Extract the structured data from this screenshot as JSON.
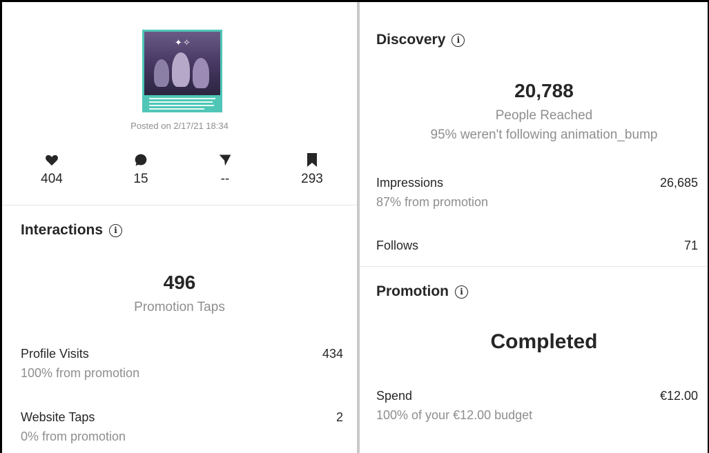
{
  "post": {
    "posted_text": "Posted on 2/17/21 18:34",
    "stats": [
      {
        "icon": "heart-icon",
        "value": "404"
      },
      {
        "icon": "comment-icon",
        "value": "15"
      },
      {
        "icon": "share-icon",
        "value": "--"
      },
      {
        "icon": "bookmark-icon",
        "value": "293"
      }
    ]
  },
  "interactions": {
    "title": "Interactions",
    "total": "496",
    "total_label": "Promotion Taps",
    "rows": [
      {
        "label": "Profile Visits",
        "sub": "100% from promotion",
        "value": "434"
      },
      {
        "label": "Website Taps",
        "sub": "0% from promotion",
        "value": "2"
      }
    ]
  },
  "discovery": {
    "title": "Discovery",
    "total": "20,788",
    "total_label": "People Reached",
    "total_sub": "95% weren't following animation_bump",
    "rows": [
      {
        "label": "Impressions",
        "sub": "87% from promotion",
        "value": "26,685"
      },
      {
        "label": "Follows",
        "sub": "",
        "value": "71"
      }
    ]
  },
  "promotion": {
    "title": "Promotion",
    "status": "Completed",
    "spend_label": "Spend",
    "spend_sub": "100% of your €12.00 budget",
    "spend_value": "€12.00"
  },
  "colors": {
    "text": "#262626",
    "muted": "#8e8e8e",
    "thumb_border": "#4fc6b6"
  }
}
